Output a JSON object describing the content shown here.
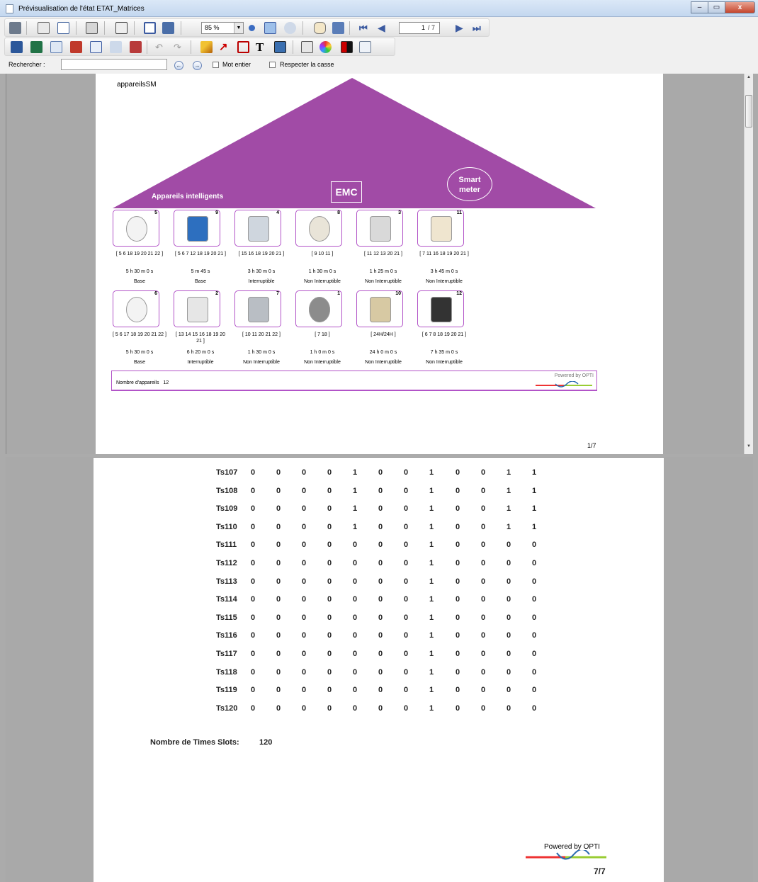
{
  "window": {
    "title": "Prévisualisation de l'état ETAT_Matrices",
    "min": "–",
    "max": "▭",
    "close": "x"
  },
  "toolbar": {
    "zoom": "85 %",
    "page_current": "1",
    "page_total": "/ 7"
  },
  "search": {
    "label": "Rechercher :",
    "placeholder": "",
    "whole_word": "Mot entier",
    "match_case": "Respecter la casse"
  },
  "page1": {
    "doc_title": "appareilsSM",
    "roof_label": "Appareils intelligents",
    "emc": "EMC",
    "smart_line1": "Smart",
    "smart_line2": "meter",
    "devices": [
      {
        "num": "5",
        "slots": "[ 5 6 18 19 20 21 22 ]",
        "dur": "5 h 30 m 0 s",
        "type": "Base",
        "icon": "smart-bulb-icon"
      },
      {
        "num": "9",
        "slots": "[ 5 6 7 12 18 19 20 21 ]",
        "dur": "5 m 45 s",
        "type": "Base",
        "icon": "water-pump-icon"
      },
      {
        "num": "4",
        "slots": "[ 15 16 18 19 20 21 ]",
        "dur": "3 h 30 m 0 s",
        "type": "Interruptible",
        "icon": "air-purifier-icon"
      },
      {
        "num": "8",
        "slots": "[ 9 10 11 ]",
        "dur": "1 h 30 m 0 s",
        "type": "Non Interruptible",
        "icon": "washing-machine-icon"
      },
      {
        "num": "3",
        "slots": "[ 11 12 13 20 21 ]",
        "dur": "1 h 25 m 0 s",
        "type": "Non Interruptible",
        "icon": "clothes-dryer-icon"
      },
      {
        "num": "11",
        "slots": "[ 7 11 16 18 19 20 21 ]",
        "dur": "3 h 45 m 0 s",
        "type": "Non Interruptible",
        "icon": "water-heater-icon"
      },
      {
        "num": "6",
        "slots": "[ 5 6 17 18 19 20 21 22 ]",
        "dur": "5 h 30 m 0 s",
        "type": "Base",
        "icon": "smart-bulb-icon"
      },
      {
        "num": "2",
        "slots": "[ 13 14 15 16 18 19 20 21 ]",
        "dur": "6 h 20 m 0 s",
        "type": "Interruptible",
        "icon": "air-conditioner-icon"
      },
      {
        "num": "7",
        "slots": "[ 10 11 20 21 22 ]",
        "dur": "1 h 30 m 0 s",
        "type": "Non Interruptible",
        "icon": "dishwasher-icon"
      },
      {
        "num": "1",
        "slots": "[ 7 18 ]",
        "dur": "1 h 0 m 0 s",
        "type": "Non Interruptible",
        "icon": "kettle-icon"
      },
      {
        "num": "10",
        "slots": "[ 24H/24H ]",
        "dur": "24 h 0 m 0 s",
        "type": "Non Interruptible",
        "icon": "refrigerator-icon"
      },
      {
        "num": "12",
        "slots": "[ 6 7 8 18 19 20 21 ]",
        "dur": "7 h 35 m 0 s",
        "type": "Non Interruptible",
        "icon": "oil-heater-icon"
      }
    ],
    "count_label": "Nombre d'appareils",
    "count_value": "12",
    "powered": "Powered by OPTI",
    "page_num": "1/7"
  },
  "page7": {
    "rows": [
      {
        "ts": "Ts107",
        "v": [
          0,
          0,
          0,
          0,
          1,
          0,
          0,
          1,
          0,
          0,
          1,
          1
        ]
      },
      {
        "ts": "Ts108",
        "v": [
          0,
          0,
          0,
          0,
          1,
          0,
          0,
          1,
          0,
          0,
          1,
          1
        ]
      },
      {
        "ts": "Ts109",
        "v": [
          0,
          0,
          0,
          0,
          1,
          0,
          0,
          1,
          0,
          0,
          1,
          1
        ]
      },
      {
        "ts": "Ts110",
        "v": [
          0,
          0,
          0,
          0,
          1,
          0,
          0,
          1,
          0,
          0,
          1,
          1
        ]
      },
      {
        "ts": "Ts111",
        "v": [
          0,
          0,
          0,
          0,
          0,
          0,
          0,
          1,
          0,
          0,
          0,
          0
        ]
      },
      {
        "ts": "Ts112",
        "v": [
          0,
          0,
          0,
          0,
          0,
          0,
          0,
          1,
          0,
          0,
          0,
          0
        ]
      },
      {
        "ts": "Ts113",
        "v": [
          0,
          0,
          0,
          0,
          0,
          0,
          0,
          1,
          0,
          0,
          0,
          0
        ]
      },
      {
        "ts": "Ts114",
        "v": [
          0,
          0,
          0,
          0,
          0,
          0,
          0,
          1,
          0,
          0,
          0,
          0
        ]
      },
      {
        "ts": "Ts115",
        "v": [
          0,
          0,
          0,
          0,
          0,
          0,
          0,
          1,
          0,
          0,
          0,
          0
        ]
      },
      {
        "ts": "Ts116",
        "v": [
          0,
          0,
          0,
          0,
          0,
          0,
          0,
          1,
          0,
          0,
          0,
          0
        ]
      },
      {
        "ts": "Ts117",
        "v": [
          0,
          0,
          0,
          0,
          0,
          0,
          0,
          1,
          0,
          0,
          0,
          0
        ]
      },
      {
        "ts": "Ts118",
        "v": [
          0,
          0,
          0,
          0,
          0,
          0,
          0,
          1,
          0,
          0,
          0,
          0
        ]
      },
      {
        "ts": "Ts119",
        "v": [
          0,
          0,
          0,
          0,
          0,
          0,
          0,
          1,
          0,
          0,
          0,
          0
        ]
      },
      {
        "ts": "Ts120",
        "v": [
          0,
          0,
          0,
          0,
          0,
          0,
          0,
          1,
          0,
          0,
          0,
          0
        ]
      }
    ],
    "nts_label": "Nombre de Times Slots:",
    "nts_value": "120",
    "powered": "Powered by OPTI",
    "page_num": "7/7"
  },
  "colors": {
    "roof": "#a14ba6",
    "border": "#b254c8"
  }
}
